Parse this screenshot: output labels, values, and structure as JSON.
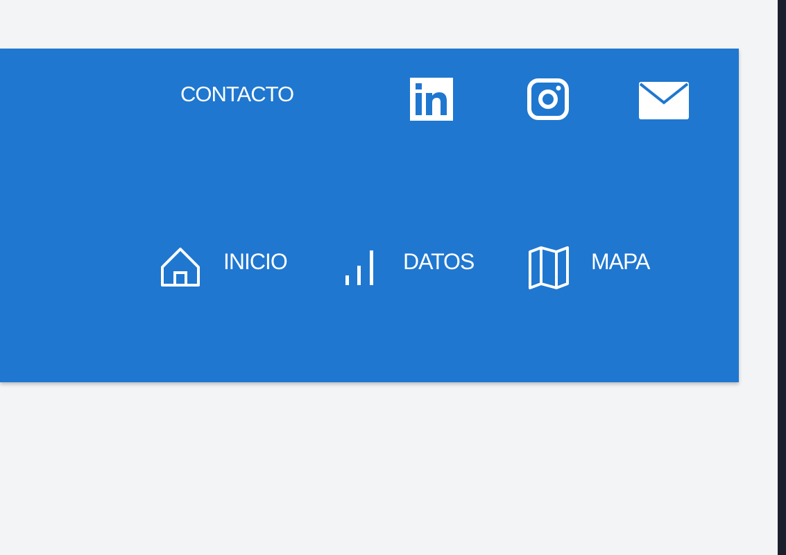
{
  "header": {
    "background_color": "#1f77d0",
    "top_bar": {
      "contact_label": "CONTACTO",
      "social_icons": [
        "linkedin-icon",
        "instagram-icon",
        "mail-icon"
      ]
    },
    "nav": {
      "items": [
        {
          "label": "INICIO",
          "icon": "home-icon"
        },
        {
          "label": "DATOS",
          "icon": "bar-chart-icon"
        },
        {
          "label": "MAPA",
          "icon": "map-icon"
        }
      ]
    }
  },
  "page": {
    "background_color": "#f3f4f6",
    "edge_color": "#1b1e2b"
  }
}
